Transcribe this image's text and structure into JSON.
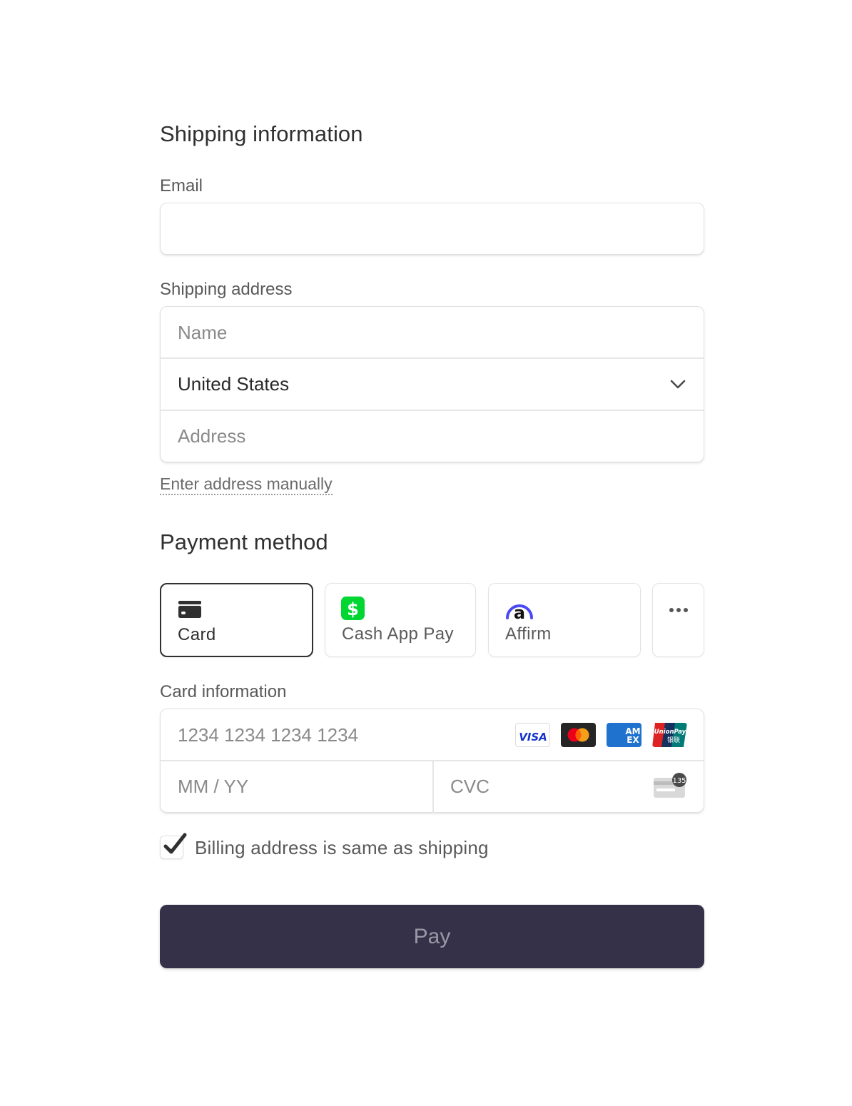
{
  "shipping": {
    "title": "Shipping information",
    "email_label": "Email",
    "email_value": "",
    "email_placeholder": "",
    "address_label": "Shipping address",
    "name_placeholder": "Name",
    "country_value": "United States",
    "address_placeholder": "Address",
    "manual_link": "Enter address manually"
  },
  "payment": {
    "title": "Payment method",
    "methods": [
      {
        "label": "Card",
        "icon": "credit-card-icon",
        "selected": true
      },
      {
        "label": "Cash App Pay",
        "icon": "cash-app-icon",
        "selected": false
      },
      {
        "label": "Affirm",
        "icon": "affirm-icon",
        "selected": false
      },
      {
        "label": "",
        "icon": "more-options-icon",
        "selected": false
      }
    ],
    "card_info_label": "Card information",
    "card_number_placeholder": "1234 1234 1234 1234",
    "expiry_placeholder": "MM / YY",
    "cvc_placeholder": "CVC",
    "cvc_hint": "135",
    "card_brands": [
      "VISA",
      "Mastercard",
      "AMEX",
      "UnionPay"
    ],
    "brand_text": {
      "visa": "VISA",
      "amex_top": "AM",
      "amex_bottom": "EX",
      "unionpay_top": "UnionPay",
      "unionpay_bottom": "银联"
    },
    "billing_same_label": "Billing address is same as shipping",
    "billing_same_checked": true,
    "pay_label": "Pay"
  },
  "colors": {
    "pay_button_bg": "#353148",
    "cash_app_green": "#00D632",
    "affirm_blue": "#4A4AF4",
    "amex_blue": "#1F72CD"
  }
}
